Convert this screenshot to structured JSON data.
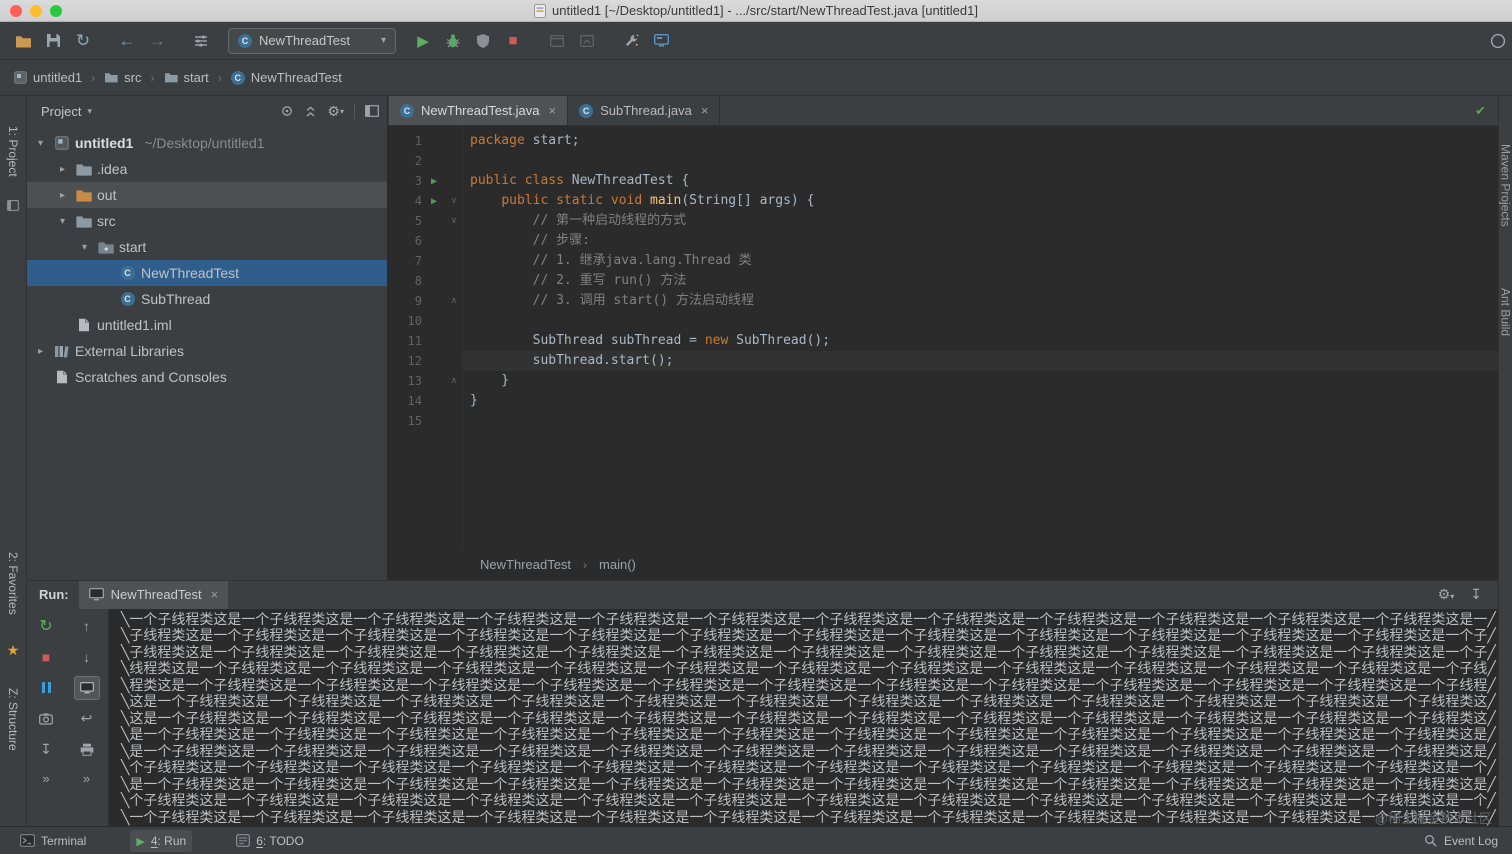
{
  "titlebar": {
    "title": "untitled1 [~/Desktop/untitled1] - .../src/start/NewThreadTest.java [untitled1]"
  },
  "toolbar": {
    "run_config": "NewThreadTest"
  },
  "breadcrumbs": {
    "items": [
      "untitled1",
      "src",
      "start",
      "NewThreadTest"
    ]
  },
  "left_stripe": {
    "project": "1: Project",
    "favorites": "2: Favorites",
    "structure": "Z: Structure"
  },
  "right_stripe": {
    "labels": [
      "Maven Projects",
      "Ant Build"
    ]
  },
  "project_panel": {
    "title": "Project",
    "tree": [
      {
        "label": "untitled1",
        "path": "~/Desktop/untitled1",
        "type": "project",
        "indent": 0,
        "arrow": "down",
        "bold": true
      },
      {
        "label": ".idea",
        "type": "folder",
        "indent": 1,
        "arrow": "right"
      },
      {
        "label": "out",
        "type": "folder-out",
        "indent": 1,
        "arrow": "right",
        "row": "hover"
      },
      {
        "label": "src",
        "type": "folder-src",
        "indent": 1,
        "arrow": "down"
      },
      {
        "label": "start",
        "type": "package",
        "indent": 2,
        "arrow": "down"
      },
      {
        "label": "NewThreadTest",
        "type": "class",
        "indent": 3,
        "row": "selected"
      },
      {
        "label": "SubThread",
        "type": "class",
        "indent": 3
      },
      {
        "label": "untitled1.iml",
        "type": "file",
        "indent": 1
      },
      {
        "label": "External Libraries",
        "type": "libraries",
        "indent": 0,
        "arrow": "right"
      },
      {
        "label": "Scratches and Consoles",
        "type": "scratches",
        "indent": 0
      }
    ]
  },
  "editor": {
    "tabs": [
      {
        "label": "NewThreadTest.java",
        "active": true
      },
      {
        "label": "SubThread.java",
        "active": false
      }
    ],
    "code": [
      {
        "n": 1,
        "segs": [
          [
            "package",
            "kw"
          ],
          [
            " start;",
            "pl"
          ]
        ]
      },
      {
        "n": 2,
        "segs": []
      },
      {
        "n": 3,
        "segs": [
          [
            "public class",
            "kw"
          ],
          [
            " NewThreadTest {",
            "pl"
          ]
        ],
        "run": true
      },
      {
        "n": 4,
        "segs": [
          [
            "    ",
            "pl"
          ],
          [
            "public static void",
            "kw"
          ],
          [
            " ",
            "pl"
          ],
          [
            "main",
            "fn"
          ],
          [
            "(String[] args) {",
            "pl"
          ]
        ],
        "run": true,
        "fold": "down"
      },
      {
        "n": 5,
        "segs": [
          [
            "        ",
            "pl"
          ],
          [
            "// 第一种启动线程的方式",
            "cm"
          ]
        ],
        "fold": "down"
      },
      {
        "n": 6,
        "segs": [
          [
            "        ",
            "pl"
          ],
          [
            "// 步骤:",
            "cm"
          ]
        ]
      },
      {
        "n": 7,
        "segs": [
          [
            "        ",
            "pl"
          ],
          [
            "// 1. 继承java.lang.Thread 类",
            "cm"
          ]
        ]
      },
      {
        "n": 8,
        "segs": [
          [
            "        ",
            "pl"
          ],
          [
            "// 2. 重写 run() 方法",
            "cm"
          ]
        ]
      },
      {
        "n": 9,
        "segs": [
          [
            "        ",
            "pl"
          ],
          [
            "// 3. 调用 start() 方法启动线程",
            "cm"
          ]
        ],
        "fold": "up"
      },
      {
        "n": 10,
        "segs": []
      },
      {
        "n": 11,
        "segs": [
          [
            "        SubThread subThread = ",
            "pl"
          ],
          [
            "new",
            "kw"
          ],
          [
            " SubThread();",
            "pl"
          ]
        ]
      },
      {
        "n": 12,
        "segs": [
          [
            "        subThread.start();",
            "pl"
          ]
        ],
        "caret": true
      },
      {
        "n": 13,
        "segs": [
          [
            "    }",
            "pl"
          ]
        ],
        "fold": "up"
      },
      {
        "n": 14,
        "segs": [
          [
            "}",
            "pl"
          ]
        ]
      },
      {
        "n": 15,
        "segs": []
      }
    ],
    "breadcrumb": [
      "NewThreadTest",
      "main()"
    ]
  },
  "run_panel": {
    "label": "Run:",
    "tab": "NewThreadTest",
    "console": {
      "repeated_text": "这是一个子线程类",
      "wrap_start": "╲",
      "wrap_end": "╱",
      "chars_per_line": 97,
      "line_offsets": [
        2,
        4,
        4,
        5,
        6,
        0,
        0,
        1,
        1,
        3,
        1,
        3,
        2
      ]
    }
  },
  "statusbar": {
    "items": [
      {
        "mnemonic": "",
        "label": "Terminal",
        "icon": "terminal",
        "active": false
      },
      {
        "mnemonic": "4",
        "label": "Run",
        "icon": "run",
        "active": true
      },
      {
        "mnemonic": "6",
        "label": "TODO",
        "icon": "todo",
        "active": false
      }
    ],
    "event_log": "Event Log",
    "watermark": "@稀土掘金技术社区"
  }
}
